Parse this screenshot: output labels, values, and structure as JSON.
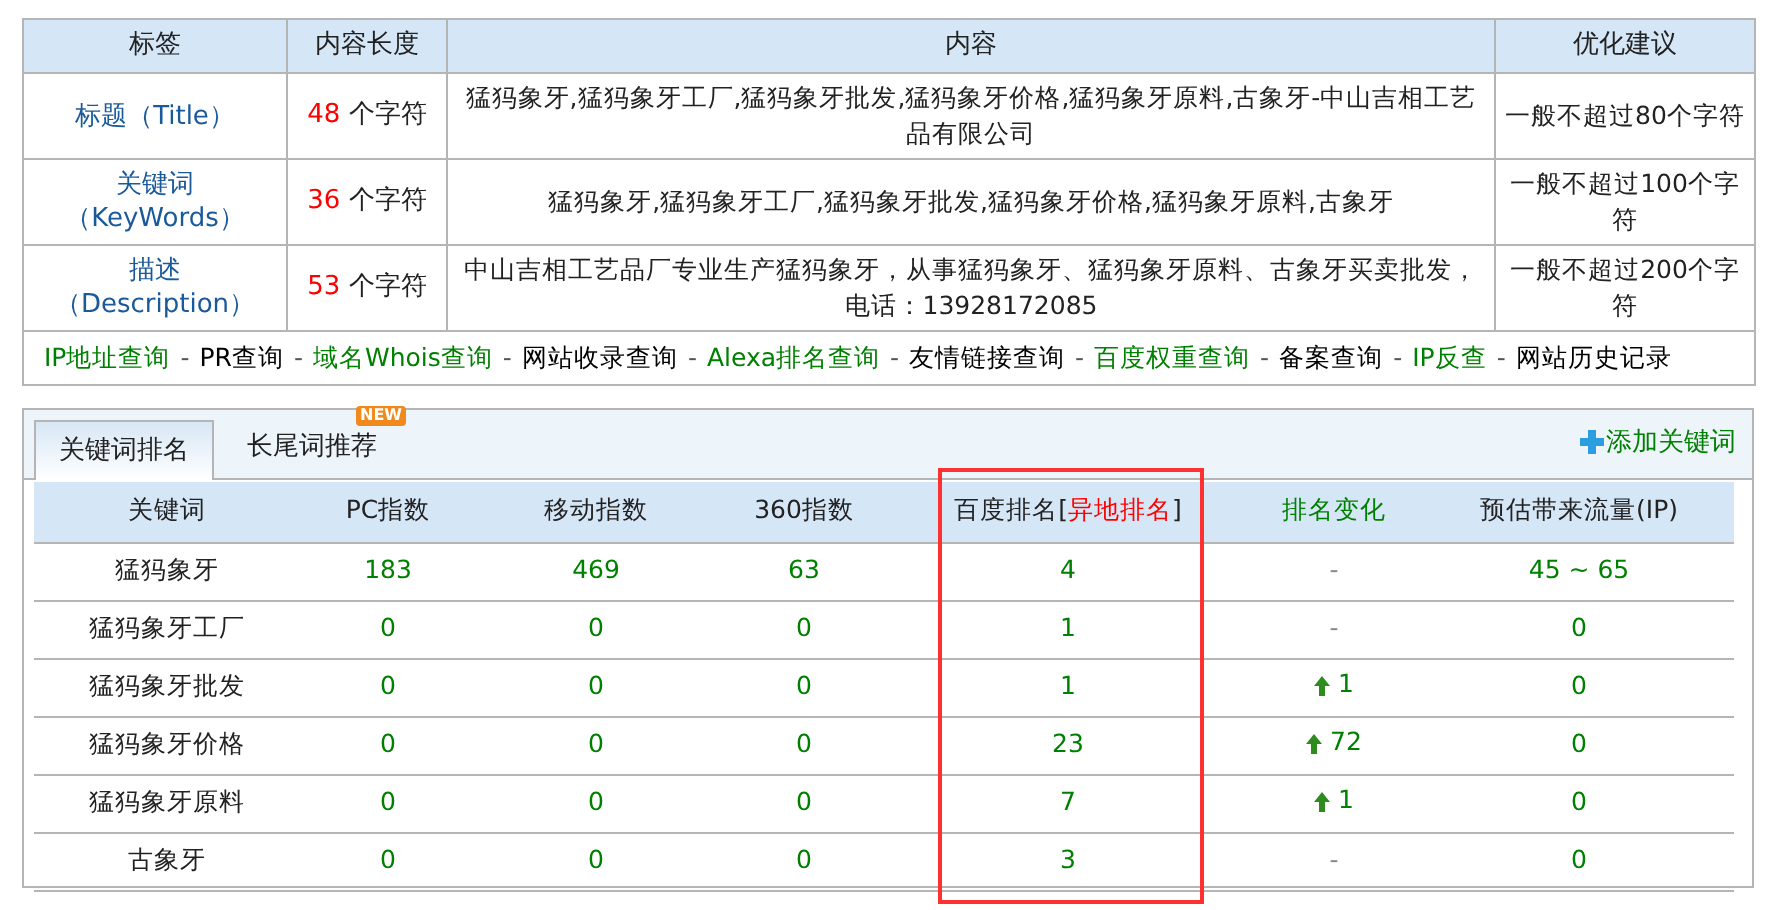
{
  "meta_table": {
    "columns": [
      "标签",
      "内容长度",
      "内容",
      "优化建议"
    ],
    "rows": [
      {
        "label": "标题（Title）",
        "count": "48",
        "unit": "个字符",
        "content": "猛犸象牙,猛犸象牙工厂,猛犸象牙批发,猛犸象牙价格,猛犸象牙原料,古象牙-中山吉相工艺品有限公司",
        "advice": "一般不超过80个字符"
      },
      {
        "label": "关键词（KeyWords）",
        "count": "36",
        "unit": "个字符",
        "content": "猛犸象牙,猛犸象牙工厂,猛犸象牙批发,猛犸象牙价格,猛犸象牙原料,古象牙",
        "advice": "一般不超过100个字符"
      },
      {
        "label": "描述（Description）",
        "count": "53",
        "unit": "个字符",
        "content": "中山吉相工艺品厂专业生产猛犸象牙，从事猛犸象牙、猛犸象牙原料、古象牙买卖批发，电话：13928172085",
        "advice": "一般不超过200个字符"
      }
    ],
    "links": [
      {
        "kind": "link",
        "text": "IP地址查询",
        "color": "#008000"
      },
      {
        "kind": "separator",
        "text": "-"
      },
      {
        "kind": "link",
        "text": "PR查询",
        "color": "#000000"
      },
      {
        "kind": "separator",
        "text": "-"
      },
      {
        "kind": "link",
        "text": "域名Whois查询",
        "color": "#008000"
      },
      {
        "kind": "separator",
        "text": "-"
      },
      {
        "kind": "link",
        "text": "网站收录查询",
        "color": "#000000"
      },
      {
        "kind": "separator",
        "text": "-"
      },
      {
        "kind": "link",
        "text": "Alexa排名查询",
        "color": "#008000"
      },
      {
        "kind": "separator",
        "text": "-"
      },
      {
        "kind": "link",
        "text": "友情链接查询",
        "color": "#000000"
      },
      {
        "kind": "separator",
        "text": "-"
      },
      {
        "kind": "link",
        "text": "百度权重查询",
        "color": "#008000"
      },
      {
        "kind": "separator",
        "text": "-"
      },
      {
        "kind": "link",
        "text": "备案查询",
        "color": "#000000"
      },
      {
        "kind": "separator",
        "text": "-"
      },
      {
        "kind": "link",
        "text": "IP反查",
        "color": "#008000"
      },
      {
        "kind": "separator",
        "text": "-"
      },
      {
        "kind": "link",
        "text": "网站历史记录",
        "color": "#000000"
      }
    ]
  },
  "ranking_panel": {
    "tabs": [
      {
        "label": "关键词排名",
        "selected": true
      },
      {
        "label": "长尾词推荐",
        "selected": false,
        "badge": "NEW"
      }
    ],
    "add_keyword": "添加关键词",
    "columns": [
      {
        "label": "关键词"
      },
      {
        "label": "PC指数"
      },
      {
        "label": "移动指数"
      },
      {
        "label": "360指数"
      },
      {
        "label": "百度排名[",
        "link": "异地排名",
        "suffix": "]",
        "highlighted": true
      },
      {
        "label": "排名变化",
        "color": "#008000"
      },
      {
        "label": "预估带来流量(IP)"
      }
    ],
    "rows": [
      {
        "keyword": "猛犸象牙",
        "pc": "183",
        "mobile": "469",
        "so360": "63",
        "baidu": "4",
        "change": {
          "kind": "none",
          "text": "-"
        },
        "traffic": "45 ~ 65"
      },
      {
        "keyword": "猛犸象牙工厂",
        "pc": "0",
        "mobile": "0",
        "so360": "0",
        "baidu": "1",
        "change": {
          "kind": "none",
          "text": "-"
        },
        "traffic": "0"
      },
      {
        "keyword": "猛犸象牙批发",
        "pc": "0",
        "mobile": "0",
        "so360": "0",
        "baidu": "1",
        "change": {
          "kind": "up",
          "text": "1"
        },
        "traffic": "0"
      },
      {
        "keyword": "猛犸象牙价格",
        "pc": "0",
        "mobile": "0",
        "so360": "0",
        "baidu": "23",
        "change": {
          "kind": "up",
          "text": "72"
        },
        "traffic": "0"
      },
      {
        "keyword": "猛犸象牙原料",
        "pc": "0",
        "mobile": "0",
        "so360": "0",
        "baidu": "7",
        "change": {
          "kind": "up",
          "text": "1"
        },
        "traffic": "0"
      },
      {
        "keyword": "古象牙",
        "pc": "0",
        "mobile": "0",
        "so360": "0",
        "baidu": "3",
        "change": {
          "kind": "none",
          "text": "-"
        },
        "traffic": "0"
      }
    ]
  }
}
